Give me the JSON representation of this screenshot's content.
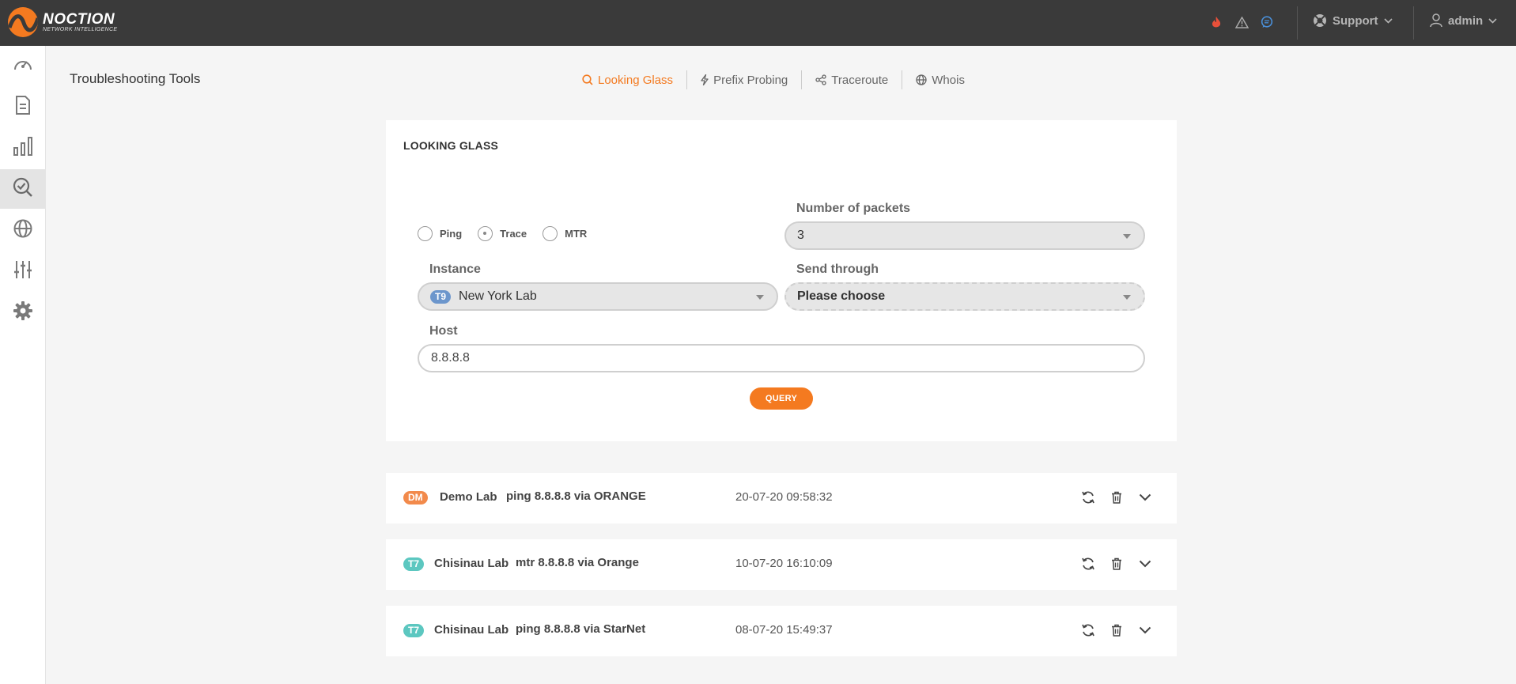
{
  "brand": {
    "name": "NOCTION",
    "tagline": "NETWORK INTELLIGENCE"
  },
  "topbar": {
    "icons": [
      "fire-icon",
      "warning-icon",
      "chat-icon"
    ],
    "support_label": "Support",
    "user_label": "admin",
    "colors": {
      "fire": "#e8503a",
      "chat": "#4a8fd8",
      "background": "#3a3a3a"
    }
  },
  "sidebar": {
    "items": [
      {
        "icon": "dashboard-icon",
        "active": false
      },
      {
        "icon": "document-icon",
        "active": false
      },
      {
        "icon": "bar-chart-icon",
        "active": false
      },
      {
        "icon": "troubleshoot-icon",
        "active": true
      },
      {
        "icon": "globe-icon",
        "active": false
      },
      {
        "icon": "sliders-icon",
        "active": false
      },
      {
        "icon": "gear-icon",
        "active": false
      }
    ]
  },
  "page": {
    "title": "Troubleshooting Tools"
  },
  "tabs": [
    {
      "label": "Looking Glass",
      "icon": "search-icon",
      "active": true
    },
    {
      "label": "Prefix Probing",
      "icon": "bolt-icon",
      "active": false
    },
    {
      "label": "Traceroute",
      "icon": "share-icon",
      "active": false
    },
    {
      "label": "Whois",
      "icon": "globe-icon",
      "active": false
    }
  ],
  "looking_glass": {
    "title": "LOOKING GLASS",
    "modes": [
      {
        "label": "Ping",
        "checked": false
      },
      {
        "label": "Trace",
        "checked": true
      },
      {
        "label": "MTR",
        "checked": false
      }
    ],
    "packets": {
      "label": "Number of packets",
      "value": "3"
    },
    "instance": {
      "label": "Instance",
      "badge": "T9",
      "value": "New York Lab"
    },
    "send_through": {
      "label": "Send through",
      "value": "Please choose"
    },
    "host": {
      "label": "Host",
      "value": "8.8.8.8"
    },
    "query_label": "QUERY",
    "accent_color": "#f47a20"
  },
  "results": [
    {
      "badge": "DM",
      "badge_color": "orange",
      "lab": "Demo Lab",
      "command": "ping 8.8.8.8 via ORANGE",
      "timestamp": "20-07-20 09:58:32"
    },
    {
      "badge": "T7",
      "badge_color": "teal",
      "lab": "Chisinau Lab",
      "command": "mtr 8.8.8.8 via Orange",
      "timestamp": "10-07-20 16:10:09"
    },
    {
      "badge": "T7",
      "badge_color": "teal",
      "lab": "Chisinau Lab",
      "command": "ping 8.8.8.8 via StarNet",
      "timestamp": "08-07-20 15:49:37"
    }
  ]
}
